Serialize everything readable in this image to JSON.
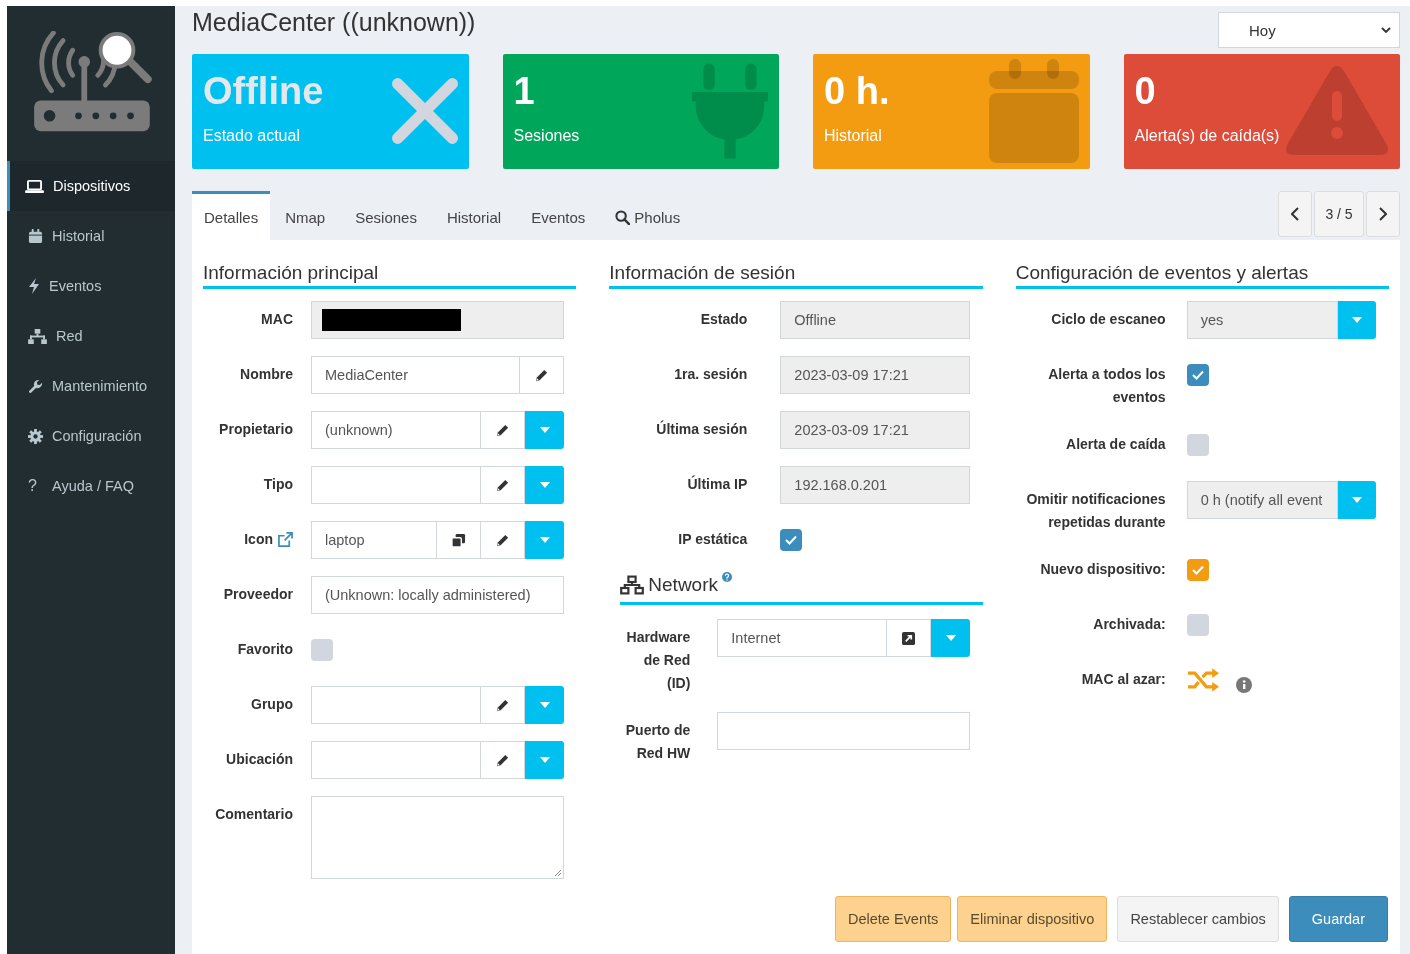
{
  "sidebar": {
    "items": [
      {
        "label": "Dispositivos",
        "selected": true
      },
      {
        "label": "Historial",
        "selected": false
      },
      {
        "label": "Eventos",
        "selected": false
      },
      {
        "label": "Red",
        "selected": false
      },
      {
        "label": "Mantenimiento",
        "selected": false
      },
      {
        "label": "Configuración",
        "selected": false
      },
      {
        "label": "Ayuda / FAQ",
        "glyph": "?",
        "selected": false
      }
    ]
  },
  "header": {
    "title": "MediaCenter ((unknown))",
    "period": "Hoy"
  },
  "stat_boxes": [
    {
      "value": "Offline",
      "label": "Estado actual",
      "color": "#00c0ef"
    },
    {
      "value": "1",
      "label": "Sesiones",
      "color": "#00a65a"
    },
    {
      "value": "0 h.",
      "label": "Historial",
      "color": "#f39c12"
    },
    {
      "value": "0",
      "label": "Alerta(s) de caída(s)",
      "color": "#dd4b39"
    }
  ],
  "tabs": [
    {
      "label": "Detalles",
      "selected": true
    },
    {
      "label": "Nmap",
      "selected": false
    },
    {
      "label": "Sesiones",
      "selected": false
    },
    {
      "label": "Historial",
      "selected": false
    },
    {
      "label": "Eventos",
      "selected": false
    },
    {
      "label": "Pholus",
      "selected": false
    }
  ],
  "pager": {
    "position": "3 / 5"
  },
  "sections": [
    {
      "title": "Información principal",
      "fields": [
        {
          "kind": "redacted",
          "label": "MAC"
        },
        {
          "kind": "input",
          "label": "Nombre",
          "value": "MediaCenter",
          "editable": true
        },
        {
          "kind": "input",
          "label": "Propietario",
          "value": "(unknown)",
          "editable": true,
          "dropdown": true
        },
        {
          "kind": "input",
          "label": "Tipo",
          "editable": true,
          "dropdown": true
        },
        {
          "kind": "input",
          "label": "Icon",
          "link_icon": true,
          "value": "laptop",
          "copyable": true,
          "editable": true,
          "dropdown": true
        },
        {
          "kind": "input",
          "label": "Proveedor",
          "value": "(Unknown: locally administered)"
        },
        {
          "kind": "checkbox",
          "label": "Favorito",
          "checked": false
        },
        {
          "kind": "input",
          "label": "Grupo",
          "editable": true,
          "dropdown": true
        },
        {
          "kind": "input",
          "label": "Ubicación",
          "editable": true,
          "dropdown": true
        },
        {
          "kind": "textarea",
          "label": "Comentario"
        }
      ]
    },
    {
      "title": "Información de sesión",
      "fields": [
        {
          "kind": "readonly",
          "label": "Estado",
          "value": "Offline"
        },
        {
          "kind": "readonly",
          "label": "1ra. sesión",
          "value": "2023-03-09   17:21"
        },
        {
          "kind": "readonly",
          "label": "Última sesión",
          "value": "2023-03-09   17:21"
        },
        {
          "kind": "readonly",
          "label": "Última IP",
          "value": "192.168.0.201"
        },
        {
          "kind": "checkbox",
          "label": "IP estática",
          "checked": true,
          "color": "#3c8dbc"
        }
      ],
      "subsection": {
        "title": "Network",
        "help": true,
        "fields": [
          {
            "kind": "input",
            "label": "Hardware de Red (ID)",
            "value": "Internet",
            "openable": true,
            "dropdown": true
          },
          {
            "kind": "input",
            "label": "Puerto de Red HW"
          }
        ]
      }
    },
    {
      "title": "Configuración de eventos y alertas",
      "fields": [
        {
          "kind": "select",
          "label": "Ciclo de escaneo",
          "value": "yes"
        },
        {
          "kind": "checkbox",
          "label": "Alerta a todos los eventos",
          "checked": true,
          "color": "#3c8dbc"
        },
        {
          "kind": "checkbox",
          "label": "Alerta de caída",
          "checked": false
        },
        {
          "kind": "select",
          "label": "Omitir notificaciones repetidas durante",
          "value": "0 h (notify all event"
        },
        {
          "kind": "checkbox",
          "label": "Nuevo dispositivo:",
          "checked": true,
          "color": "#f39c12"
        },
        {
          "kind": "checkbox",
          "label": "Archivada:",
          "checked": false
        },
        {
          "kind": "random_mac",
          "label": "MAC al azar:"
        }
      ]
    }
  ],
  "actions": [
    {
      "label": "Delete Events",
      "kind": "warning"
    },
    {
      "label": "Eliminar dispositivo",
      "kind": "warning"
    },
    {
      "label": "Restablecer cambios",
      "kind": "default"
    },
    {
      "label": "Guardar",
      "kind": "primary"
    }
  ]
}
